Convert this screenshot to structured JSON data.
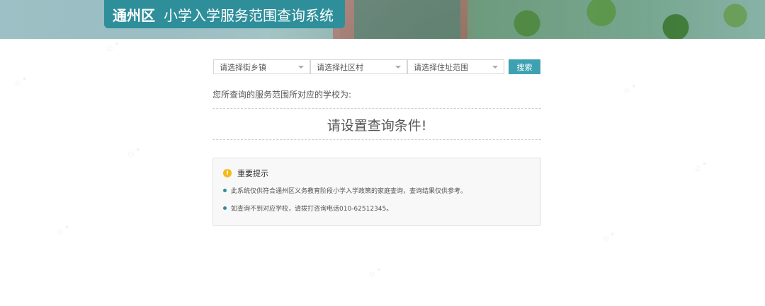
{
  "header": {
    "district": "通州区",
    "system_title": "小学入学服务范围查询系统"
  },
  "search": {
    "street_select": "请选择街乡镇",
    "community_select": "请选择社区村",
    "address_select": "请选择住址范围",
    "button_label": "搜索"
  },
  "result": {
    "label": "您所查询的服务范围所对应的学校为:",
    "placeholder": "请设置查询条件!"
  },
  "notice": {
    "icon": "info-icon",
    "title": "重要提示",
    "items": [
      "此系统仅供符合通州区义务教育阶段小学入学政策的家庭查询，查询结果仅供参考。",
      "如查询不到对应学校，请拨打咨询电话010-62512345。"
    ]
  },
  "colors": {
    "accent": "#2e8f9b",
    "button": "#3ea1b1",
    "warning": "#f2bb18"
  }
}
